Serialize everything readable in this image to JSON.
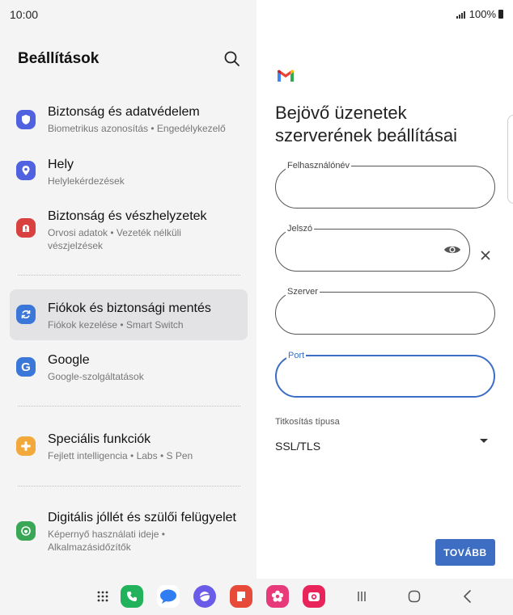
{
  "status_bar": {
    "time": "10:00",
    "battery": "100%"
  },
  "settings": {
    "title": "Beállítások",
    "items": [
      {
        "title": "Biztonság és adatvédelem",
        "subtitle": "Biometrikus azonosítás • Engedélykezelő",
        "icon": "shield-icon",
        "color": "#5162e0"
      },
      {
        "title": "Hely",
        "subtitle": "Helylekérdezések",
        "icon": "location-pin-icon",
        "color": "#5162e0"
      },
      {
        "title": "Biztonság és vészhelyzetek",
        "subtitle": "Orvosi adatok • Vezeték nélküli vészjelzések",
        "icon": "emergency-alert-icon",
        "color": "#d94040"
      },
      {
        "title": "Fiókok és biztonsági mentés",
        "subtitle": "Fiókok kezelése • Smart Switch",
        "icon": "sync-icon",
        "color": "#3b77d9"
      },
      {
        "title": "Google",
        "subtitle": "Google-szolgáltatások",
        "icon": "google-icon",
        "color": "#3b77d9"
      },
      {
        "title": "Speciális funkciók",
        "subtitle": "Fejlett intelligencia • Labs • S Pen",
        "icon": "puzzle-icon",
        "color": "#f2a93b"
      },
      {
        "title": "Digitális jóllét és szülői felügyelet",
        "subtitle": "Képernyő használati ideje • Alkalmazásidőzítők",
        "icon": "wellbeing-icon",
        "color": "#3aa757"
      }
    ]
  },
  "form": {
    "title": "Bejövő üzenetek szerverének beállításai",
    "fields": {
      "username": {
        "label": "Felhasználónév",
        "value": ""
      },
      "password": {
        "label": "Jelszó",
        "value": ""
      },
      "server": {
        "label": "Szerver",
        "value": ""
      },
      "port": {
        "label": "Port",
        "value": ""
      }
    },
    "encryption": {
      "label": "Titkosítás típusa",
      "value": "SSL/TLS"
    },
    "next_button": "TOVÁBB"
  },
  "taskbar": {
    "apps": [
      "app-drawer-icon",
      "phone-icon",
      "messages-icon",
      "internet-icon",
      "notes-icon",
      "blossom-icon",
      "camera-icon"
    ],
    "nav": [
      "recents-icon",
      "home-icon",
      "back-icon"
    ]
  }
}
